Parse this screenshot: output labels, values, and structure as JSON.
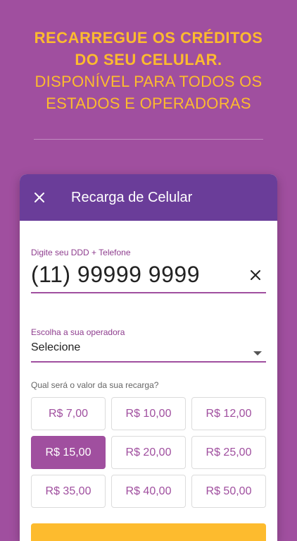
{
  "headline": {
    "line1": "RECARREGUE OS CRÉDITOS",
    "line2": "DO SEU CELULAR.",
    "line3": "DISPONÍVEL PARA TODOS OS",
    "line4": "ESTADOS E OPERADORAS"
  },
  "app": {
    "title": "Recarga de Celular",
    "close_icon": "close-icon",
    "accent": "#a04f9f",
    "appbar_color": "#6a3d99",
    "highlight": "#fdbb2e"
  },
  "phone_field": {
    "label": "Digite seu DDD + Telefone",
    "value": "(11) 99999 9999",
    "clear_icon": "clear-icon"
  },
  "operator_field": {
    "label": "Escolha a sua operadora",
    "value": "Selecione",
    "caret_icon": "dropdown-caret-icon"
  },
  "amounts": {
    "prompt": "Qual será o valor da sua recarga?",
    "options": [
      "R$ 7,00",
      "R$ 10,00",
      "R$ 12,00",
      "R$ 15,00",
      "R$ 20,00",
      "R$ 25,00",
      "R$ 35,00",
      "R$ 40,00",
      "R$ 50,00"
    ],
    "selected": "R$ 15,00"
  }
}
